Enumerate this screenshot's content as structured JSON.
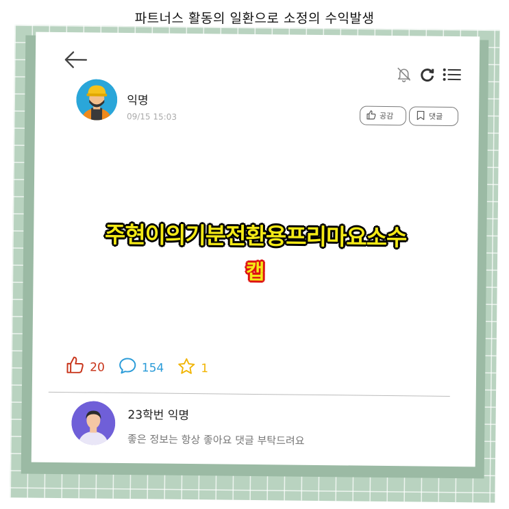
{
  "caption": "파트너스 활동의 일환으로 소정의 수익발생",
  "post": {
    "author": "익명",
    "time": "09/15 15:03",
    "like_button_label": "공감",
    "scrap_button_label": "댓글",
    "headline_line1": "주현이의기분전환용프리마요소수",
    "headline_line2": "캡",
    "likes": "20",
    "comments": "154",
    "scraps": "1"
  },
  "comment": {
    "author": "23학번 익명",
    "text": "좋은 정보는 항상 좋아요 댓글 부탁드려요"
  },
  "colors": {
    "tile_green": "#b9d3c0",
    "like_red": "#c8341a",
    "comment_blue": "#2a9bd8",
    "scrap_yellow": "#f1b400",
    "headline_yellow": "#f4ea16"
  },
  "icons": [
    "back-arrow-icon",
    "bell-off-icon",
    "refresh-icon",
    "menu-icon",
    "thumbs-up-icon",
    "bookmark-icon",
    "comment-icon",
    "star-icon"
  ]
}
